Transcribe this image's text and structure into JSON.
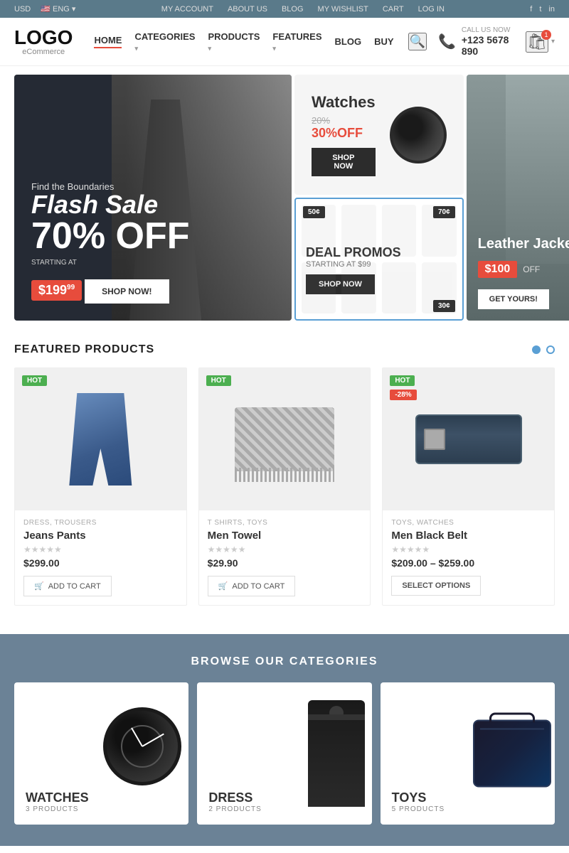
{
  "topbar": {
    "currency": "USD",
    "language": "ENG",
    "links": [
      "MY ACCOUNT",
      "ABOUT US",
      "BLOG",
      "MY WISHLIST",
      "CART",
      "LOG IN"
    ]
  },
  "header": {
    "logo": "LOGO",
    "logo_sub": "eCommerce",
    "nav": [
      "HOME",
      "CATEGORIES",
      "PRODUCTS",
      "FEATURES",
      "BLOG",
      "BUY"
    ],
    "call_label": "CALL US NOW",
    "phone": "+123 5678 890",
    "cart_count": "1"
  },
  "hero": {
    "main": {
      "find": "Find the Boundaries",
      "flash": "Flash Sale",
      "percent": "70% OFF",
      "starting": "STARTING AT",
      "price": "$199",
      "price_sup": "99",
      "button": "SHOP NOW!"
    },
    "watches": {
      "title": "Watches",
      "old_percent": "20%",
      "new_percent": "30%OFF",
      "button": "SHOP NOW"
    },
    "deal": {
      "badge1": "50¢",
      "badge2": "70¢",
      "badge3": "30¢",
      "title": "DEAL PROMOS",
      "subtitle": "STARTING AT $99",
      "button": "SHOP NOW"
    },
    "leather": {
      "title": "Leather Jackets",
      "price": "$100",
      "off": "OFF",
      "button": "GET YOURS!"
    }
  },
  "featured": {
    "title": "FEATURED PRODUCTS",
    "products": [
      {
        "badge": "HOT",
        "categories": "DRESS, TROUSERS",
        "name": "Jeans Pants",
        "price": "$299.00",
        "button": "ADD TO CART",
        "action": "add"
      },
      {
        "badge": "HOT",
        "categories": "T SHIRTS, TOYS",
        "name": "Men Towel",
        "price": "$29.90",
        "button": "ADD TO CART",
        "action": "add"
      },
      {
        "badge": "HOT",
        "sale_badge": "-28%",
        "categories": "TOYS, WATCHES",
        "name": "Men Black Belt",
        "price": "$209.00 – $259.00",
        "button": "SELECT OPTIONS",
        "action": "select"
      }
    ]
  },
  "categories": {
    "title": "BROWSE OUR CATEGORIES",
    "items": [
      {
        "name": "WATCHES",
        "count": "3 PRODUCTS"
      },
      {
        "name": "DRESS",
        "count": "2 PRODUCTS"
      },
      {
        "name": "TOYS",
        "count": "5 PRODUCTS"
      }
    ]
  }
}
